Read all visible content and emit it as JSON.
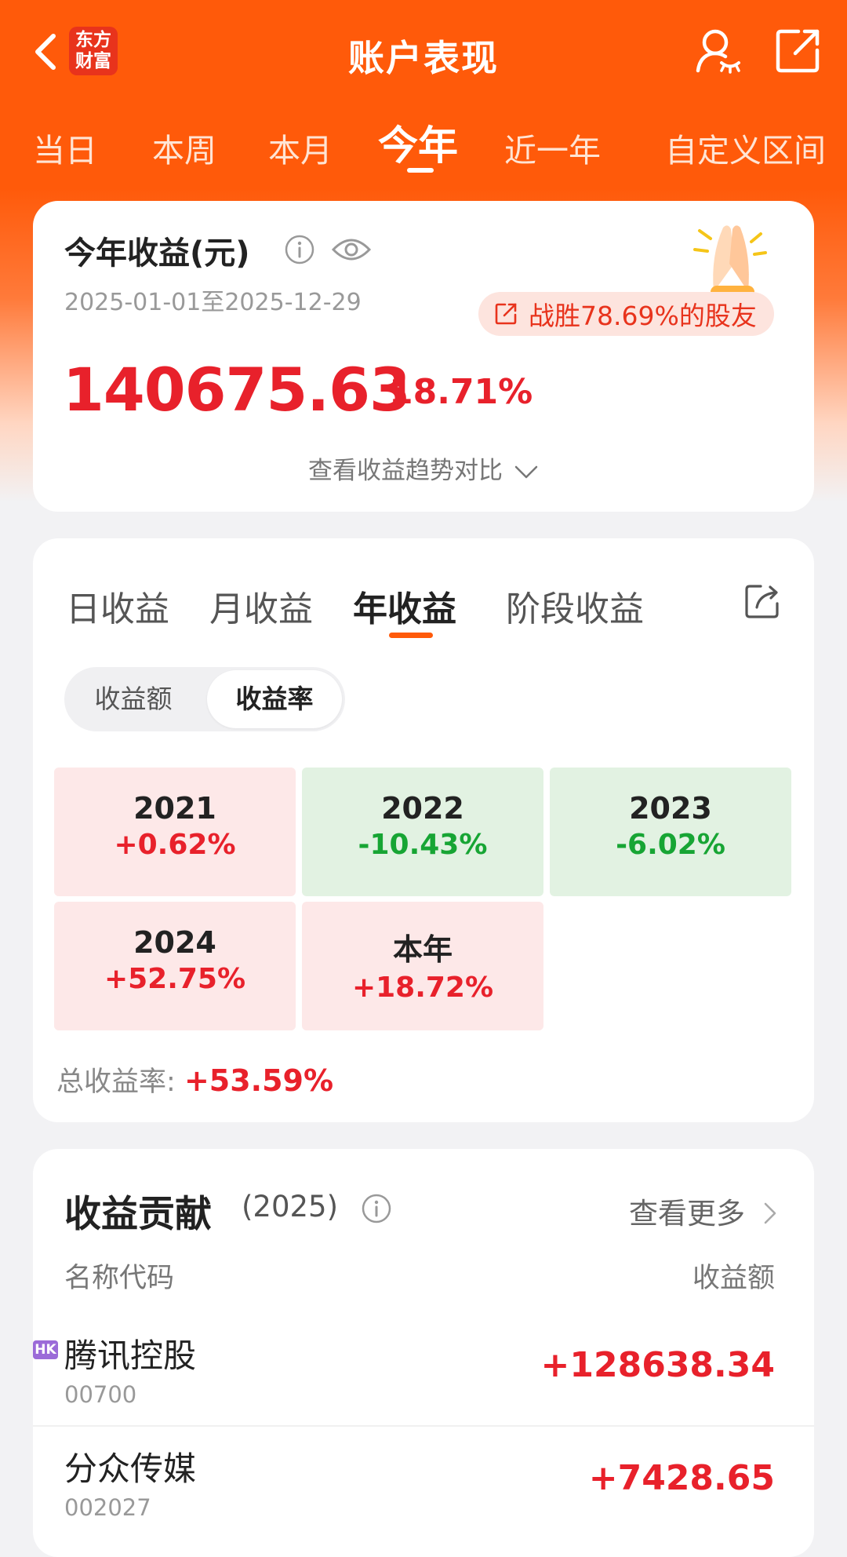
{
  "header": {
    "title": "账户表现",
    "logo_line1": "东方",
    "logo_line2": "财富"
  },
  "period_tabs": [
    {
      "label": "当日"
    },
    {
      "label": "本周"
    },
    {
      "label": "本月"
    },
    {
      "label": "今年",
      "active": true
    },
    {
      "label": "近一年"
    },
    {
      "label": "自定义区间"
    }
  ],
  "summary": {
    "title": "今年收益(元)",
    "date_range": "2025-01-01至2025-12-29",
    "beat_text": "战胜78.69%的股友",
    "amount": "140675.63",
    "rate": "18.71%",
    "trend_link": "查看收益趋势对比"
  },
  "returns": {
    "tabs": [
      {
        "label": "日收益"
      },
      {
        "label": "月收益"
      },
      {
        "label": "年收益",
        "active": true
      },
      {
        "label": "阶段收益"
      }
    ],
    "segment": [
      {
        "label": "收益额"
      },
      {
        "label": "收益率",
        "active": true
      }
    ],
    "cells": [
      {
        "year": "2021",
        "value": "+0.62%",
        "trend": "up"
      },
      {
        "year": "2022",
        "value": "-10.43%",
        "trend": "down"
      },
      {
        "year": "2023",
        "value": "-6.02%",
        "trend": "down"
      },
      {
        "year": "2024",
        "value": "+52.75%",
        "trend": "up"
      },
      {
        "year": "本年",
        "value": "+18.72%",
        "trend": "up"
      }
    ],
    "total_label": "总收益率:",
    "total_value": "+53.59%"
  },
  "contribution": {
    "title": "收益贡献",
    "year": "(2025)",
    "more": "查看更多",
    "col_name": "名称代码",
    "col_amount": "收益额",
    "rows": [
      {
        "market_badge": "HK",
        "name": "腾讯控股",
        "code": "00700",
        "amount": "+128638.34"
      },
      {
        "name": "分众传媒",
        "code": "002027",
        "amount": "+7428.65"
      }
    ]
  },
  "colors": {
    "brand": "#ff5a0a",
    "gain": "#e8212b",
    "loss": "#17a534"
  }
}
